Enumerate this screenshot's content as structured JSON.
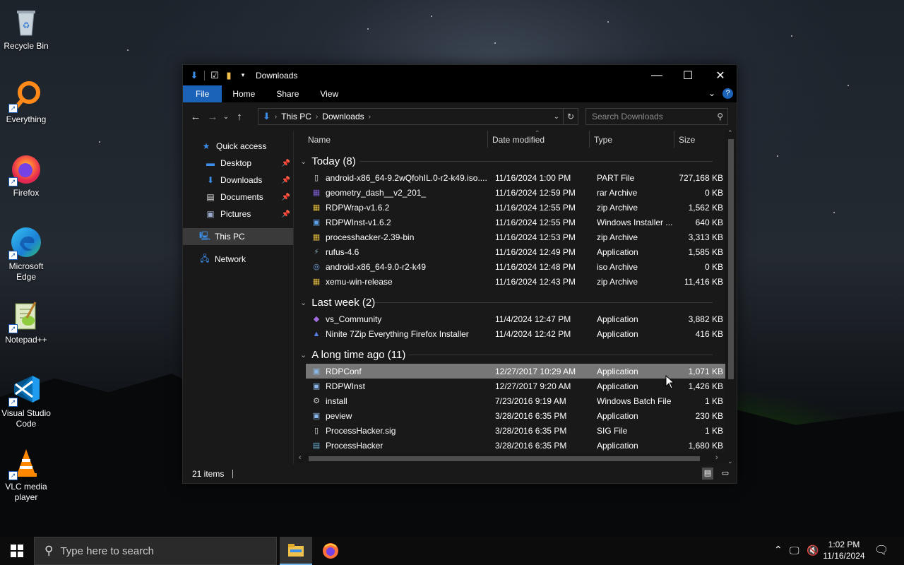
{
  "desktop": {
    "icons": [
      {
        "label": "Recycle Bin",
        "icon": "recycle-bin-icon"
      },
      {
        "label": "Everything",
        "icon": "everything-icon"
      },
      {
        "label": "Firefox",
        "icon": "firefox-icon"
      },
      {
        "label": "Microsoft Edge",
        "icon": "edge-icon"
      },
      {
        "label": "Notepad++",
        "icon": "notepadpp-icon"
      },
      {
        "label": "Visual Studio Code",
        "icon": "vscode-icon"
      },
      {
        "label": "VLC media player",
        "icon": "vlc-icon"
      }
    ]
  },
  "window": {
    "title": "Downloads",
    "ribbon_tabs": [
      "File",
      "Home",
      "Share",
      "View"
    ],
    "address": {
      "segments": [
        "This PC",
        "Downloads"
      ]
    },
    "search_placeholder": "Search Downloads",
    "nav": {
      "quick_access": "Quick access",
      "pinned": [
        "Desktop",
        "Downloads",
        "Documents",
        "Pictures"
      ],
      "this_pc": "This PC",
      "network": "Network"
    },
    "columns": [
      "Name",
      "Date modified",
      "Type",
      "Size"
    ],
    "groups": [
      {
        "label": "Today (8)",
        "files": [
          {
            "name": "android-x86_64-9.2wQfohIL.0-r2-k49.iso....",
            "date": "11/16/2024 1:00 PM",
            "type": "PART File",
            "size": "727,168 KB",
            "icon": "file-icon"
          },
          {
            "name": "geometry_dash__v2_201_",
            "date": "11/16/2024 12:59 PM",
            "type": "rar Archive",
            "size": "0 KB",
            "icon": "rar-icon"
          },
          {
            "name": "RDPWrap-v1.6.2",
            "date": "11/16/2024 12:55 PM",
            "type": "zip Archive",
            "size": "1,562 KB",
            "icon": "zip-icon"
          },
          {
            "name": "RDPWInst-v1.6.2",
            "date": "11/16/2024 12:55 PM",
            "type": "Windows Installer ...",
            "size": "640 KB",
            "icon": "msi-icon"
          },
          {
            "name": "processhacker-2.39-bin",
            "date": "11/16/2024 12:53 PM",
            "type": "zip Archive",
            "size": "3,313 KB",
            "icon": "zip-icon"
          },
          {
            "name": "rufus-4.6",
            "date": "11/16/2024 12:49 PM",
            "type": "Application",
            "size": "1,585 KB",
            "icon": "usb-icon"
          },
          {
            "name": "android-x86_64-9.0-r2-k49",
            "date": "11/16/2024 12:48 PM",
            "type": "iso Archive",
            "size": "0 KB",
            "icon": "iso-icon"
          },
          {
            "name": "xemu-win-release",
            "date": "11/16/2024 12:43 PM",
            "type": "zip Archive",
            "size": "11,416 KB",
            "icon": "zip-icon"
          }
        ]
      },
      {
        "label": "Last week (2)",
        "files": [
          {
            "name": "vs_Community",
            "date": "11/4/2024 12:47 PM",
            "type": "Application",
            "size": "3,882 KB",
            "icon": "visual-studio-icon"
          },
          {
            "name": "Ninite 7Zip Everything Firefox Installer",
            "date": "11/4/2024 12:42 PM",
            "type": "Application",
            "size": "416 KB",
            "icon": "ninite-icon"
          }
        ]
      },
      {
        "label": "A long time ago (11)",
        "files": [
          {
            "name": "RDPConf",
            "date": "12/27/2017 10:29 AM",
            "type": "Application",
            "size": "1,071 KB",
            "icon": "app-window-icon",
            "selected": true
          },
          {
            "name": "RDPWInst",
            "date": "12/27/2017 9:20 AM",
            "type": "Application",
            "size": "1,426 KB",
            "icon": "app-window-icon"
          },
          {
            "name": "install",
            "date": "7/23/2016 9:19 AM",
            "type": "Windows Batch File",
            "size": "1 KB",
            "icon": "batch-gear-icon"
          },
          {
            "name": "peview",
            "date": "3/28/2016 6:35 PM",
            "type": "Application",
            "size": "230 KB",
            "icon": "app-window-icon"
          },
          {
            "name": "ProcessHacker.sig",
            "date": "3/28/2016 6:35 PM",
            "type": "SIG File",
            "size": "1 KB",
            "icon": "file-icon"
          },
          {
            "name": "ProcessHacker",
            "date": "3/28/2016 6:35 PM",
            "type": "Application",
            "size": "1,680 KB",
            "icon": "monitor-app-icon"
          }
        ]
      }
    ],
    "status": "21 items"
  },
  "taskbar": {
    "search_placeholder": "Type here to search",
    "time": "1:02 PM",
    "date": "11/16/2024"
  }
}
